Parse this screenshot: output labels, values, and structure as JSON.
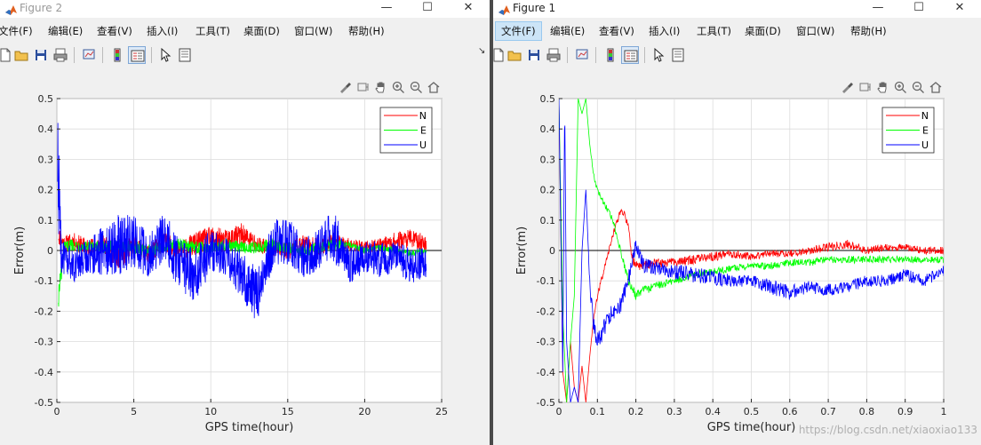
{
  "windows": [
    {
      "id": "figure2",
      "title": "Figure 2",
      "menu": [
        "文件(F)",
        "编辑(E)",
        "查看(V)",
        "插入(I)",
        "工具(T)",
        "桌面(D)",
        "窗口(W)",
        "帮助(H)"
      ],
      "active_menu": -1,
      "controls": {
        "minimize": "—",
        "maximize": "☐",
        "close": "✕"
      },
      "overflow_arrow": "↘"
    },
    {
      "id": "figure1",
      "title": "Figure 1",
      "menu": [
        "文件(F)",
        "编辑(E)",
        "查看(V)",
        "插入(I)",
        "工具(T)",
        "桌面(D)",
        "窗口(W)",
        "帮助(H)"
      ],
      "active_menu": 0,
      "controls": {
        "minimize": "—",
        "maximize": "☐",
        "close": "✕"
      }
    }
  ],
  "toolbar_icons": [
    "new-file-icon",
    "open-folder-icon",
    "save-icon",
    "print-icon",
    "link-plot-icon",
    "colorbar-icon",
    "legend-icon",
    "arrow-pointer-icon",
    "property-inspector-icon"
  ],
  "axes_toolbar_icons": [
    "brush-icon",
    "data-tips-icon",
    "pan-hand-icon",
    "zoom-in-icon",
    "zoom-out-icon",
    "home-icon"
  ],
  "watermark": "https://blog.csdn.net/xiaoxiao133",
  "chart_data": [
    {
      "type": "line",
      "window": "figure2",
      "xlabel": "GPS time(hour)",
      "ylabel": "Error(m)",
      "xlim": [
        0,
        25
      ],
      "ylim": [
        -0.5,
        0.5
      ],
      "xticks": [
        0,
        5,
        10,
        15,
        20,
        25
      ],
      "yticks": [
        -0.5,
        -0.4,
        -0.3,
        -0.2,
        -0.1,
        0,
        0.1,
        0.2,
        0.3,
        0.4,
        0.5
      ],
      "grid": true,
      "legend_position": "top-right",
      "series": [
        {
          "name": "N",
          "color": "#ff0000",
          "x": [
            0.1,
            0.5,
            1,
            2,
            3,
            4,
            5,
            6,
            7,
            8,
            9,
            10,
            11,
            12,
            13,
            14,
            15,
            16,
            17,
            18,
            19,
            20,
            21,
            22,
            23,
            24
          ],
          "y": [
            0.05,
            0.02,
            0.03,
            0.01,
            0.02,
            -0.02,
            0.01,
            -0.01,
            0.03,
            0.0,
            0.02,
            0.04,
            0.03,
            0.05,
            0.02,
            0.01,
            0.0,
            0.02,
            0.01,
            0.03,
            0.02,
            0.01,
            0.02,
            0.03,
            0.04,
            0.02
          ],
          "amplitude": [
            0.03,
            0.03,
            0.03,
            0.03,
            0.03,
            0.04,
            0.04,
            0.03,
            0.03,
            0.03,
            0.04,
            0.04,
            0.04,
            0.04,
            0.03,
            0.03,
            0.03,
            0.03,
            0.03,
            0.03,
            0.02,
            0.02,
            0.02,
            0.03,
            0.03,
            0.03
          ]
        },
        {
          "name": "E",
          "color": "#00ff00",
          "x": [
            0.1,
            0.5,
            1,
            2,
            3,
            4,
            5,
            6,
            7,
            8,
            9,
            10,
            11,
            12,
            13,
            14,
            15,
            16,
            17,
            18,
            19,
            20,
            21,
            22,
            23,
            24
          ],
          "y": [
            -0.15,
            0.01,
            0.02,
            0.01,
            0.01,
            0.02,
            0.01,
            0.0,
            0.01,
            0.02,
            0.01,
            0.01,
            0.02,
            0.01,
            0.01,
            0.02,
            0.01,
            0.0,
            0.01,
            0.02,
            0.02,
            0.0,
            0.01,
            0.0,
            -0.01,
            0.0
          ],
          "amplitude": [
            0.05,
            0.02,
            0.02,
            0.02,
            0.02,
            0.02,
            0.02,
            0.02,
            0.02,
            0.02,
            0.02,
            0.02,
            0.02,
            0.02,
            0.02,
            0.02,
            0.02,
            0.02,
            0.02,
            0.02,
            0.01,
            0.01,
            0.01,
            0.01,
            0.01,
            0.01
          ]
        },
        {
          "name": "U",
          "color": "#0000ff",
          "x": [
            0.05,
            0.3,
            1,
            2,
            3,
            4,
            5,
            6,
            7,
            8,
            9,
            10,
            11,
            12,
            13,
            14,
            15,
            16,
            17,
            18,
            19,
            20,
            21,
            22,
            23,
            24
          ],
          "y": [
            0.3,
            -0.02,
            -0.05,
            -0.02,
            0.0,
            0.02,
            0.03,
            -0.02,
            0.05,
            -0.05,
            -0.08,
            0.0,
            -0.02,
            -0.08,
            -0.15,
            0.02,
            0.03,
            -0.02,
            0.0,
            0.05,
            -0.05,
            -0.02,
            -0.03,
            -0.02,
            -0.05,
            -0.04
          ],
          "amplitude": [
            0.2,
            0.06,
            0.06,
            0.06,
            0.08,
            0.1,
            0.09,
            0.07,
            0.08,
            0.09,
            0.1,
            0.07,
            0.06,
            0.08,
            0.09,
            0.08,
            0.08,
            0.07,
            0.07,
            0.1,
            0.06,
            0.05,
            0.06,
            0.05,
            0.06,
            0.05
          ]
        }
      ]
    },
    {
      "type": "line",
      "window": "figure1",
      "xlabel": "GPS time(hour)",
      "ylabel": "Error(m)",
      "xlim": [
        0,
        1
      ],
      "ylim": [
        -0.5,
        0.5
      ],
      "xticks": [
        0,
        0.1,
        0.2,
        0.3,
        0.4,
        0.5,
        0.6,
        0.7,
        0.8,
        0.9,
        1
      ],
      "yticks": [
        -0.5,
        -0.4,
        -0.3,
        -0.2,
        -0.1,
        0,
        0.1,
        0.2,
        0.3,
        0.4,
        0.5
      ],
      "grid": true,
      "legend_position": "top-right",
      "series": [
        {
          "name": "N",
          "color": "#ff0000",
          "x": [
            0.0,
            0.01,
            0.02,
            0.03,
            0.04,
            0.05,
            0.06,
            0.07,
            0.08,
            0.09,
            0.1,
            0.12,
            0.14,
            0.16,
            0.17,
            0.18,
            0.19,
            0.2,
            0.22,
            0.25,
            0.3,
            0.35,
            0.4,
            0.45,
            0.5,
            0.55,
            0.6,
            0.65,
            0.7,
            0.75,
            0.8,
            0.85,
            0.9,
            0.95,
            1.0
          ],
          "y": [
            0.5,
            -0.4,
            -0.5,
            -0.3,
            -0.45,
            -0.5,
            -0.38,
            -0.5,
            -0.35,
            -0.22,
            -0.15,
            -0.05,
            0.05,
            0.13,
            0.12,
            0.08,
            -0.02,
            -0.05,
            -0.05,
            -0.04,
            -0.04,
            -0.03,
            -0.02,
            -0.01,
            -0.02,
            -0.01,
            -0.01,
            0.0,
            0.01,
            0.02,
            0.0,
            0.01,
            0.01,
            0.0,
            0.0
          ],
          "amplitude": [
            0.0,
            0.0,
            0.0,
            0.0,
            0.0,
            0.0,
            0.0,
            0.0,
            0.0,
            0.01,
            0.01,
            0.01,
            0.01,
            0.01,
            0.01,
            0.01,
            0.02,
            0.015,
            0.015,
            0.015,
            0.015,
            0.015,
            0.015,
            0.015,
            0.012,
            0.012,
            0.012,
            0.012,
            0.015,
            0.015,
            0.012,
            0.012,
            0.012,
            0.012,
            0.012
          ]
        },
        {
          "name": "E",
          "color": "#00ff00",
          "x": [
            0.0,
            0.01,
            0.02,
            0.03,
            0.04,
            0.05,
            0.06,
            0.07,
            0.08,
            0.09,
            0.1,
            0.12,
            0.14,
            0.16,
            0.18,
            0.2,
            0.22,
            0.25,
            0.3,
            0.35,
            0.4,
            0.45,
            0.5,
            0.55,
            0.6,
            0.65,
            0.7,
            0.75,
            0.8,
            0.85,
            0.9,
            0.95,
            1.0
          ],
          "y": [
            0.5,
            -0.2,
            -0.5,
            -0.3,
            -0.15,
            0.5,
            0.45,
            0.5,
            0.35,
            0.25,
            0.2,
            0.15,
            0.1,
            0.0,
            -0.1,
            -0.15,
            -0.13,
            -0.12,
            -0.1,
            -0.08,
            -0.07,
            -0.06,
            -0.05,
            -0.05,
            -0.04,
            -0.04,
            -0.03,
            -0.03,
            -0.03,
            -0.03,
            -0.03,
            -0.03,
            -0.03
          ],
          "amplitude": [
            0.0,
            0.0,
            0.0,
            0.0,
            0.0,
            0.0,
            0.0,
            0.0,
            0.0,
            0.01,
            0.01,
            0.01,
            0.01,
            0.01,
            0.015,
            0.015,
            0.015,
            0.015,
            0.012,
            0.012,
            0.012,
            0.012,
            0.012,
            0.012,
            0.012,
            0.012,
            0.012,
            0.012,
            0.012,
            0.012,
            0.012,
            0.012,
            0.012
          ]
        },
        {
          "name": "U",
          "color": "#0000ff",
          "x": [
            0.0,
            0.01,
            0.015,
            0.02,
            0.03,
            0.04,
            0.05,
            0.06,
            0.07,
            0.08,
            0.09,
            0.1,
            0.12,
            0.14,
            0.16,
            0.18,
            0.2,
            0.22,
            0.25,
            0.3,
            0.35,
            0.4,
            0.45,
            0.5,
            0.55,
            0.6,
            0.65,
            0.7,
            0.75,
            0.8,
            0.85,
            0.9,
            0.95,
            1.0
          ],
          "y": [
            0.5,
            -0.4,
            0.5,
            -0.3,
            -0.5,
            -0.45,
            -0.5,
            0.0,
            0.2,
            -0.1,
            -0.25,
            -0.3,
            -0.25,
            -0.2,
            -0.18,
            -0.1,
            0.02,
            -0.05,
            -0.06,
            -0.07,
            -0.08,
            -0.09,
            -0.1,
            -0.1,
            -0.12,
            -0.14,
            -0.12,
            -0.13,
            -0.12,
            -0.1,
            -0.1,
            -0.08,
            -0.1,
            -0.07
          ],
          "amplitude": [
            0.0,
            0.0,
            0.0,
            0.0,
            0.0,
            0.0,
            0.0,
            0.0,
            0.0,
            0.02,
            0.03,
            0.03,
            0.03,
            0.03,
            0.03,
            0.03,
            0.02,
            0.025,
            0.025,
            0.025,
            0.025,
            0.025,
            0.02,
            0.02,
            0.025,
            0.025,
            0.02,
            0.02,
            0.02,
            0.02,
            0.02,
            0.02,
            0.02,
            0.02
          ]
        }
      ]
    }
  ]
}
